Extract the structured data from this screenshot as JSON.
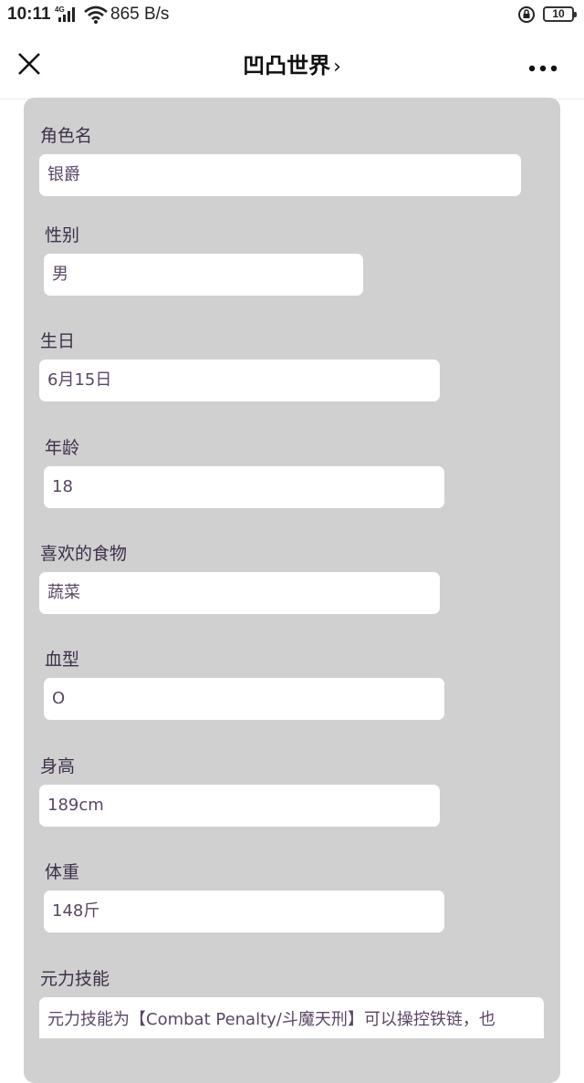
{
  "status_bar": {
    "time": "10:11",
    "network_type": "4G",
    "speed": "865 B/s",
    "battery": "10"
  },
  "nav": {
    "title": "凹凸世界",
    "chevron": "›",
    "close_icon": "close-icon",
    "more_icon": "more-icon"
  },
  "form": {
    "fields": [
      {
        "label": "角色名",
        "value": "银爵"
      },
      {
        "label": "性别",
        "value": "男"
      },
      {
        "label": "生日",
        "value": "6月15日"
      },
      {
        "label": "年龄",
        "value": "18"
      },
      {
        "label": "喜欢的食物",
        "value": "蔬菜"
      },
      {
        "label": "血型",
        "value": "O"
      },
      {
        "label": "身高",
        "value": "189cm"
      },
      {
        "label": "体重",
        "value": "148斤"
      },
      {
        "label": "元力技能",
        "value": "元力技能为【Combat Penalty/斗魔天刑】可以操控铁链，也"
      }
    ]
  },
  "colors": {
    "card_bg": "#d0d0d0",
    "label_text": "#3d2f4a",
    "input_text": "#5a4666"
  }
}
